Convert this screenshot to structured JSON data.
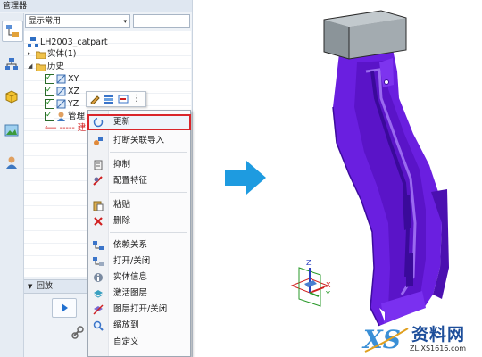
{
  "panel": {
    "title": "管理器",
    "filter": {
      "selected": "显示常用",
      "arrow": "▾"
    }
  },
  "tree": {
    "root": "LH2003_catpart",
    "solids": "实体(1)",
    "history": "历史",
    "items": [
      "XY",
      "XZ",
      "YZ",
      "管理"
    ],
    "hint": "⟵ ----- 建"
  },
  "rollback": {
    "label": "回放",
    "toggle": "▼"
  },
  "context_menu": {
    "items": [
      {
        "label": "更新",
        "icon": "refresh-icon",
        "highlighted": true
      },
      {
        "label": "打断关联导入",
        "icon": "break-link-icon"
      },
      {
        "label": "抑制",
        "icon": "suppress-icon"
      },
      {
        "label": "配置特征",
        "icon": "configure-icon"
      },
      {
        "label": "粘贴",
        "icon": "paste-icon"
      },
      {
        "label": "删除",
        "icon": "delete-icon"
      },
      {
        "label": "依赖关系",
        "icon": "dependency-icon"
      },
      {
        "label": "打开/关闭",
        "icon": "toggle-icon"
      },
      {
        "label": "实体信息",
        "icon": "info-icon"
      },
      {
        "label": "激活图层",
        "icon": "layer-icon"
      },
      {
        "label": "图层打开/关闭",
        "icon": "layer-toggle-icon"
      },
      {
        "label": "缩放到",
        "icon": "zoom-icon"
      },
      {
        "label": "自定义",
        "icon": ""
      }
    ]
  },
  "colors": {
    "accent_arrow": "#1e9be0",
    "model_purple": "#6a1fe0",
    "block_gray": "#9aa3a8",
    "highlight_red": "#d9252b"
  },
  "watermark": {
    "big": "资料网",
    "small": "ZL.XS1616.com"
  },
  "axes": {
    "x": "X",
    "y": "Y",
    "z": "Z"
  }
}
